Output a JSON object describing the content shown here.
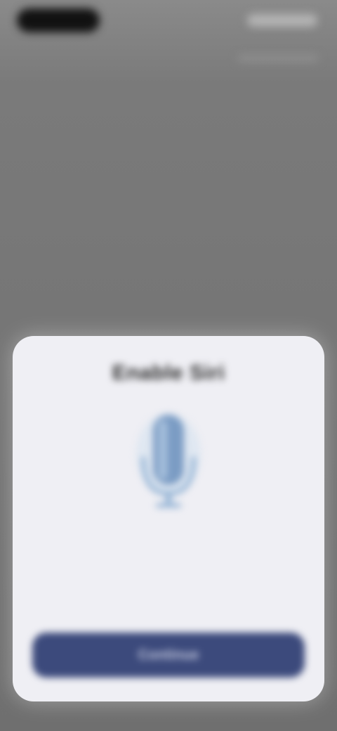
{
  "status_bar": {
    "time": "",
    "right_text": ""
  },
  "dialog": {
    "title": "Enable Siri",
    "icon": "microphone-icon",
    "body": "",
    "primary_button_label": "Continue"
  },
  "colors": {
    "background": "#7a7a7a",
    "sheet": "#efeff4",
    "button": "#3c4a7c",
    "mic": "#7b9cc4"
  }
}
